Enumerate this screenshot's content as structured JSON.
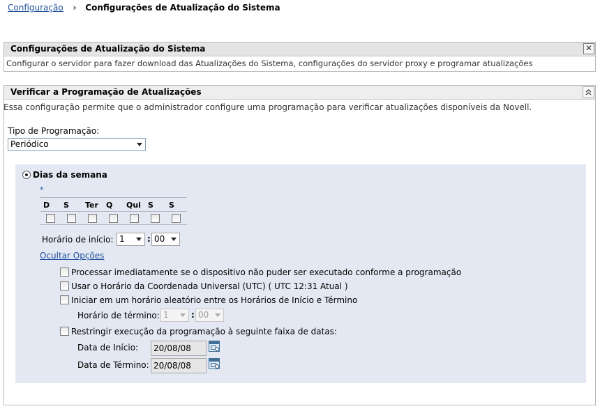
{
  "breadcrumb": {
    "root": "Configuração",
    "current": "Configurações de Atualização do Sistema"
  },
  "panel_settings": {
    "title": "Configurações de Atualização do Sistema",
    "description": "Configurar o servidor para fazer download das Atualizações do Sistema, configurações do servidor proxy e programar atualizações",
    "close_glyph": "✕"
  },
  "panel_schedule": {
    "title": "Verificar a Programação de Atualizações",
    "description": "Essa configuração permite que o administrador configure uma programação para verificar atualizações disponíveis da Novell.",
    "schedule_type_label": "Tipo de Programação:",
    "schedule_type_value": "Periódico",
    "days_radio_label": "Dias da semana",
    "required_mark": "*",
    "days": [
      {
        "label": "D",
        "checked": false
      },
      {
        "label": "S",
        "checked": false
      },
      {
        "label": "Ter",
        "checked": false
      },
      {
        "label": "Q",
        "checked": false
      },
      {
        "label": "Qui",
        "checked": false
      },
      {
        "label": "S",
        "checked": false
      },
      {
        "label": "S",
        "checked": false
      }
    ],
    "start_time_label": "Horário de início:",
    "start_hour": "1",
    "start_minute": "00",
    "time_separator": ":",
    "hide_options_link": "Ocultar Opções",
    "options": {
      "process_immediately": "Processar imediatamente se o dispositivo não puder ser executado conforme a programação",
      "use_utc": "Usar o Horário da Coordenada Universal (UTC)  ( UTC 12:31 Atual )",
      "random_start": "Iniciar em um horário aleatório entre os Horários de Início e Término",
      "restrict_dates": "Restringir execução da programação à seguinte faixa de datas:"
    },
    "end_time_label": "Horário de término:",
    "end_hour": "1",
    "end_minute": "00",
    "start_date_label": "Data de Início:",
    "start_date_value": "20/08/08",
    "end_date_label": "Data de Término:",
    "end_date_value": "20/08/08"
  },
  "colors": {
    "link": "#1f4e9c",
    "inner_panel": "#e3e8f2",
    "header_bg": "#e4e4e4"
  }
}
